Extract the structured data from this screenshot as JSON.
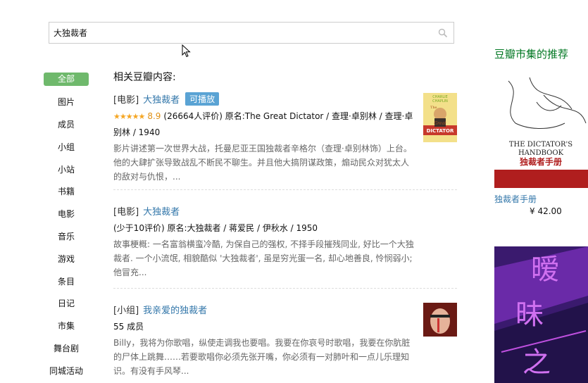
{
  "search": {
    "value": "大独裁者"
  },
  "sidebar": {
    "items": [
      {
        "label": "全部",
        "active": true
      },
      {
        "label": "图片"
      },
      {
        "label": "成员"
      },
      {
        "label": "小组"
      },
      {
        "label": "小站"
      },
      {
        "label": "书籍"
      },
      {
        "label": "电影"
      },
      {
        "label": "音乐"
      },
      {
        "label": "游戏"
      },
      {
        "label": "条目"
      },
      {
        "label": "日记"
      },
      {
        "label": "市集"
      },
      {
        "label": "舞台剧"
      },
      {
        "label": "同城活动"
      }
    ]
  },
  "main": {
    "heading": "相关豆瓣内容:",
    "results": [
      {
        "type": "[电影]",
        "title": "大独裁者",
        "badge": "可播放",
        "stars": "★★★★★",
        "rating": "8.9",
        "meta_line": "(26664人评价)    原名:The Great Dictator / 查理·卓别林 / 查理·卓别林 / 1940",
        "desc": "影片讲述第一次世界大战，托曼尼亚王国独裁者辛格尔（查理·卓别林饰）上台。他的大肆扩张导致战乱不断民不聊生。并且他大搞阴谋政策，煽动民众对犹太人的敌对与仇恨，...",
        "poster_text": [
          "CHARLIE",
          "CHAPLIN",
          "The",
          "Great",
          "DICTATOR"
        ]
      },
      {
        "type": "[电影]",
        "title": "大独裁者",
        "meta_line": "(少于10评价)    原名:大独裁者 / 蒋爱民 / 伊秋水 / 1950",
        "desc": "故事梗概: 一名富翁横蛮冷酷, 为保自己的强权, 不择手段摧残同业, 好比一个大独裁者. 一个小流氓, 相貌酷似 '大独裁者', 虽是穷光蛋一名, 却心地善良, 怜悯弱小; 他冒充..."
      },
      {
        "type": "[小组]",
        "title": "我亲爱的独裁者",
        "meta_line": "55 成员",
        "desc": "Billy，我将为你歌唱，纵使走调我也要唱。我要在你哀号时歌唱，我要在你肮脏的尸体上跳舞……若要歌唱你必须先张开嘴，你必须有一对肺叶和一点儿乐理知识。有没有手风琴..."
      }
    ]
  },
  "recommend": {
    "title": "豆瓣市集的推荐",
    "items": [
      {
        "cover_text": [
          "THE DICTATOR'S",
          "HANDBOOK",
          "独裁者手册"
        ],
        "title": "独裁者手册",
        "price": "¥ 42.00"
      },
      {
        "cover_text": [
          "暧",
          "昧",
          "之"
        ]
      }
    ]
  },
  "colors": {
    "accent_green": "#6fb96c",
    "link_blue": "#3377aa",
    "badge_blue": "#5aa3d4",
    "rec_title_green": "#007722"
  }
}
